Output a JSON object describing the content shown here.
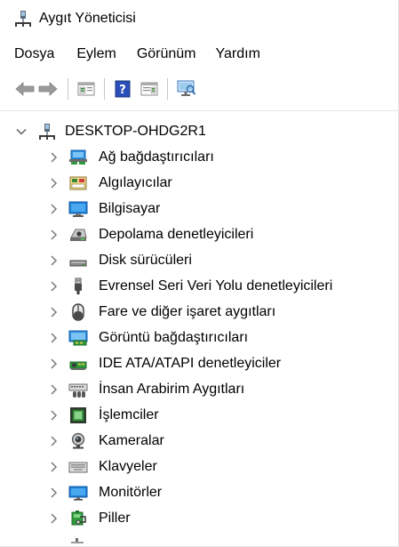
{
  "window": {
    "title": "Aygıt Yöneticisi"
  },
  "menu": {
    "items": [
      {
        "label": "Dosya"
      },
      {
        "label": "Eylem"
      },
      {
        "label": "Görünüm"
      },
      {
        "label": "Yardım"
      }
    ]
  },
  "toolbar": {
    "buttons": [
      {
        "icon": "back-arrow-icon"
      },
      {
        "icon": "forward-arrow-icon"
      },
      {
        "icon": "properties-pane-icon"
      },
      {
        "icon": "help-icon"
      },
      {
        "icon": "action-pane-icon"
      },
      {
        "icon": "scan-monitor-icon"
      }
    ]
  },
  "tree": {
    "root": {
      "label": "DESKTOP-OHDG2R1",
      "expanded": true,
      "icon": "computer-icon"
    },
    "children": [
      {
        "label": "Ağ bağdaştırıcıları",
        "icon": "network-adapter-icon"
      },
      {
        "label": "Algılayıcılar",
        "icon": "sensor-icon"
      },
      {
        "label": "Bilgisayar",
        "icon": "computer-monitor-icon"
      },
      {
        "label": "Depolama denetleyicileri",
        "icon": "storage-controller-icon"
      },
      {
        "label": "Disk sürücüleri",
        "icon": "disk-drive-icon"
      },
      {
        "label": "Evrensel Seri Veri Yolu denetleyicileri",
        "icon": "usb-icon"
      },
      {
        "label": "Fare ve diğer işaret aygıtları",
        "icon": "mouse-icon"
      },
      {
        "label": "Görüntü bağdaştırıcıları",
        "icon": "display-adapter-icon"
      },
      {
        "label": "IDE ATA/ATAPI denetleyiciler",
        "icon": "ide-controller-icon"
      },
      {
        "label": "İnsan Arabirim Aygıtları",
        "icon": "hid-icon"
      },
      {
        "label": "İşlemciler",
        "icon": "processor-icon"
      },
      {
        "label": "Kameralar",
        "icon": "camera-icon"
      },
      {
        "label": "Klavyeler",
        "icon": "keyboard-icon"
      },
      {
        "label": "Monitörler",
        "icon": "monitor-icon"
      },
      {
        "label": "Piller",
        "icon": "battery-icon"
      }
    ]
  },
  "colors": {
    "accent_blue": "#1e7fd8",
    "chevron": "#7a7a7a"
  }
}
